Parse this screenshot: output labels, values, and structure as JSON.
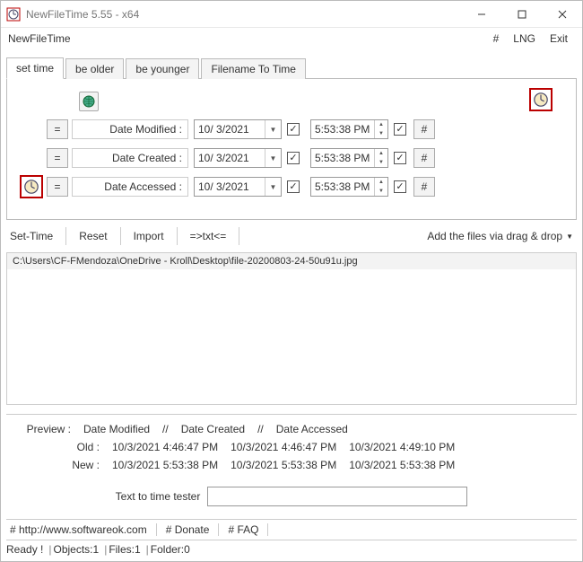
{
  "window": {
    "title": "NewFileTime 5.55 - x64"
  },
  "menubar": {
    "app_name": "NewFileTime",
    "hash": "#",
    "lng": "LNG",
    "exit": "Exit"
  },
  "tabs": {
    "set_time": "set time",
    "be_older": "be older",
    "be_younger": "be younger",
    "filename_to_time": "Filename To Time"
  },
  "rows": {
    "eq": "=",
    "hash": "#",
    "modified": {
      "label": "Date Modified :",
      "date": "10/ 3/2021",
      "time": "5:53:38 PM"
    },
    "created": {
      "label": "Date Created :",
      "date": "10/ 3/2021",
      "time": "5:53:38 PM"
    },
    "accessed": {
      "label": "Date Accessed :",
      "date": "10/ 3/2021",
      "time": "5:53:38 PM"
    }
  },
  "actions": {
    "set_time": "Set-Time",
    "reset": "Reset",
    "import": "Import",
    "txt": "=>txt<=",
    "drag_hint": "Add the files via drag & drop"
  },
  "file_list": {
    "items": [
      "C:\\Users\\CF-FMendoza\\OneDrive - Kroll\\Desktop\\file-20200803-24-50u91u.jpg"
    ]
  },
  "preview": {
    "header_label": "Preview  :",
    "header_modified": "Date Modified",
    "header_created": "Date Created",
    "header_accessed": "Date Accessed",
    "sep": "//",
    "old_label": "Old  :",
    "new_label": "New  :",
    "old": {
      "modified": "10/3/2021 4:46:47 PM",
      "created": "10/3/2021 4:46:47 PM",
      "accessed": "10/3/2021 4:49:10 PM"
    },
    "new": {
      "modified": "10/3/2021 5:53:38 PM",
      "created": "10/3/2021 5:53:38 PM",
      "accessed": "10/3/2021 5:53:38 PM"
    }
  },
  "tester": {
    "label": "Text to time tester",
    "value": ""
  },
  "bottom_links": {
    "site": "# http://www.softwareok.com",
    "donate": "# Donate",
    "faq": "# FAQ"
  },
  "status": {
    "ready": "Ready !",
    "objects": "Objects:1",
    "files": "Files:1",
    "folder": "Folder:0"
  }
}
